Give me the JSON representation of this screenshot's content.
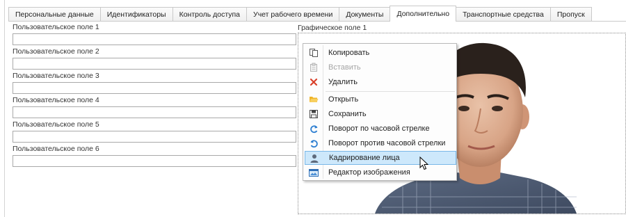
{
  "tabs": [
    {
      "label": "Персональные данные",
      "active": false
    },
    {
      "label": "Идентификаторы",
      "active": false
    },
    {
      "label": "Контроль доступа",
      "active": false
    },
    {
      "label": "Учет рабочего времени",
      "active": false
    },
    {
      "label": "Документы",
      "active": false
    },
    {
      "label": "Дополнительно",
      "active": true
    },
    {
      "label": "Транспортные средства",
      "active": false
    },
    {
      "label": "Пропуск",
      "active": false
    }
  ],
  "fields": [
    {
      "label": "Пользовательское поле 1",
      "value": ""
    },
    {
      "label": "Пользовательское поле 2",
      "value": ""
    },
    {
      "label": "Пользовательское поле 3",
      "value": ""
    },
    {
      "label": "Пользовательское поле 4",
      "value": ""
    },
    {
      "label": "Пользовательское поле 5",
      "value": ""
    },
    {
      "label": "Пользовательское поле 6",
      "value": ""
    }
  ],
  "photo": {
    "label": "Графическое поле 1"
  },
  "context_menu": {
    "items": [
      {
        "label": "Копировать",
        "icon": "copy-icon",
        "enabled": true
      },
      {
        "label": "Вставить",
        "icon": "paste-icon",
        "enabled": false
      },
      {
        "label": "Удалить",
        "icon": "delete-icon",
        "enabled": true
      },
      {
        "label": "Открыть",
        "icon": "open-folder-icon",
        "enabled": true
      },
      {
        "label": "Сохранить",
        "icon": "save-icon",
        "enabled": true
      },
      {
        "label": "Поворот по часовой стрелке",
        "icon": "rotate-clockwise-icon",
        "enabled": true
      },
      {
        "label": "Поворот против часовой стрелки",
        "icon": "rotate-counterclockwise-icon",
        "enabled": true
      },
      {
        "label": "Кадрирование лица",
        "icon": "face-crop-icon",
        "enabled": true,
        "highlighted": true
      },
      {
        "label": "Редактор изображения",
        "icon": "image-editor-icon",
        "enabled": true
      }
    ]
  },
  "colors": {
    "highlight_bg": "#cde8fb",
    "highlight_border": "#7ab8e8",
    "delete_icon": "#d9402a",
    "folder_icon": "#f0b429",
    "rotate_icon": "#2e7fd1"
  }
}
